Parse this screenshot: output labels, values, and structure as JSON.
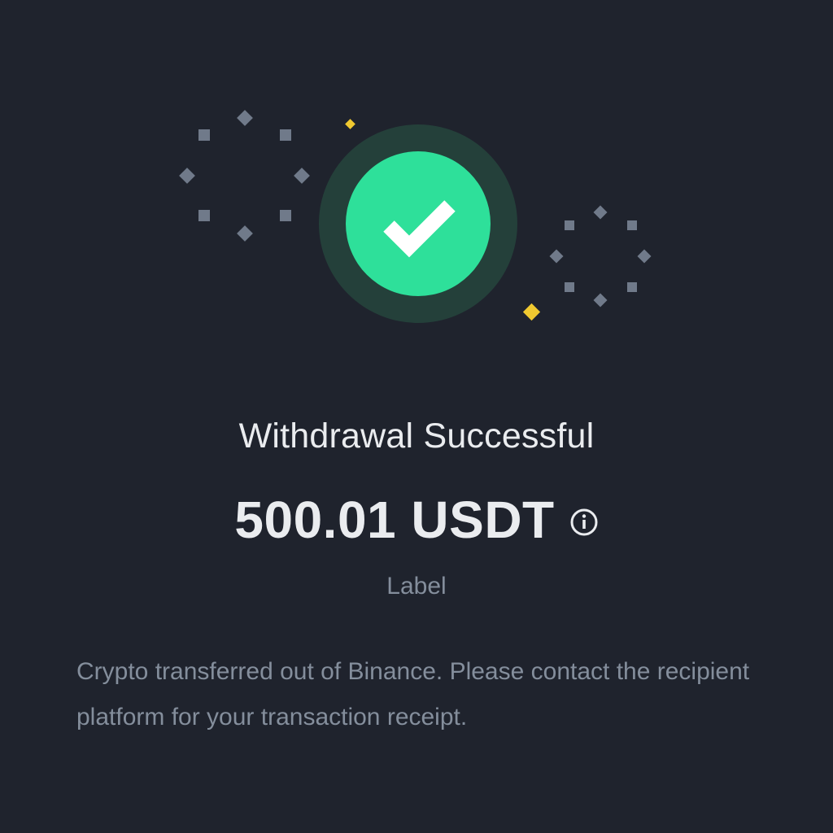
{
  "colors": {
    "background": "#1f232d",
    "success_green": "#2ee09a",
    "halo": "#24403a",
    "confetti_gray": "#707a8a",
    "confetti_yellow": "#f0c930",
    "text_primary": "#eaecef",
    "text_secondary": "#848e9c"
  },
  "icons": {
    "status": "checkmark-icon",
    "info": "info-icon",
    "decoration": "confetti-icon"
  },
  "status": {
    "title": "Withdrawal Successful",
    "amount": "500.01 USDT",
    "label": "Label",
    "description": "Crypto transferred out of Binance. Please contact the recipient platform for your transaction receipt."
  }
}
